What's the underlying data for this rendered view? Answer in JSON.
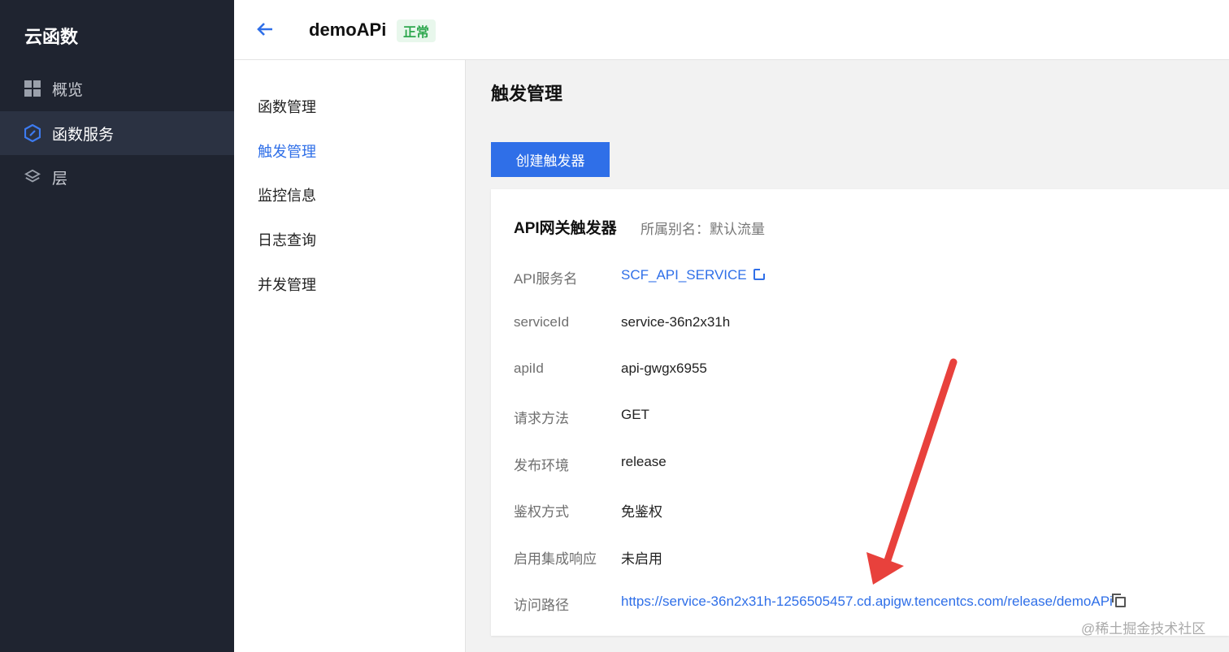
{
  "sidebar": {
    "app_title": "云函数",
    "items": [
      {
        "label": "概览",
        "icon": "dashboard-grid-icon"
      },
      {
        "label": "函数服务",
        "icon": "function-hexagon-icon"
      },
      {
        "label": "层",
        "icon": "layers-icon"
      }
    ]
  },
  "header": {
    "back_icon": "arrow-left-icon",
    "function_name": "demoAPi",
    "status": "正常"
  },
  "submenu": {
    "items": [
      {
        "label": "函数管理"
      },
      {
        "label": "触发管理"
      },
      {
        "label": "监控信息"
      },
      {
        "label": "日志查询"
      },
      {
        "label": "并发管理"
      }
    ],
    "active": "触发管理"
  },
  "main": {
    "page_title": "触发管理",
    "create_button": "创建触发器",
    "trigger": {
      "title": "API网关触发器",
      "alias": "所属别名：默认流量",
      "rows": [
        {
          "label": "API服务名",
          "value": "SCF_API_SERVICE"
        },
        {
          "label": "serviceId",
          "value": "service-36n2x31h"
        },
        {
          "label": "apiId",
          "value": "api-gwgx6955"
        },
        {
          "label": "请求方法",
          "value": "GET"
        },
        {
          "label": "发布环境",
          "value": "release"
        },
        {
          "label": "鉴权方式",
          "value": "免鉴权"
        },
        {
          "label": "启用集成响应",
          "value": "未启用"
        },
        {
          "label": "访问路径",
          "value": "https://service-36n2x31h-1256505457.cd.apigw.tencentcs.com/release/demoAPi"
        }
      ]
    }
  },
  "colors": {
    "sidebar_bg": "#1f2430",
    "accent": "#2f6fe8",
    "status_green": "#2fa84f",
    "annotation_red": "#e8413c"
  },
  "watermark": "@稀土掘金技术社区"
}
